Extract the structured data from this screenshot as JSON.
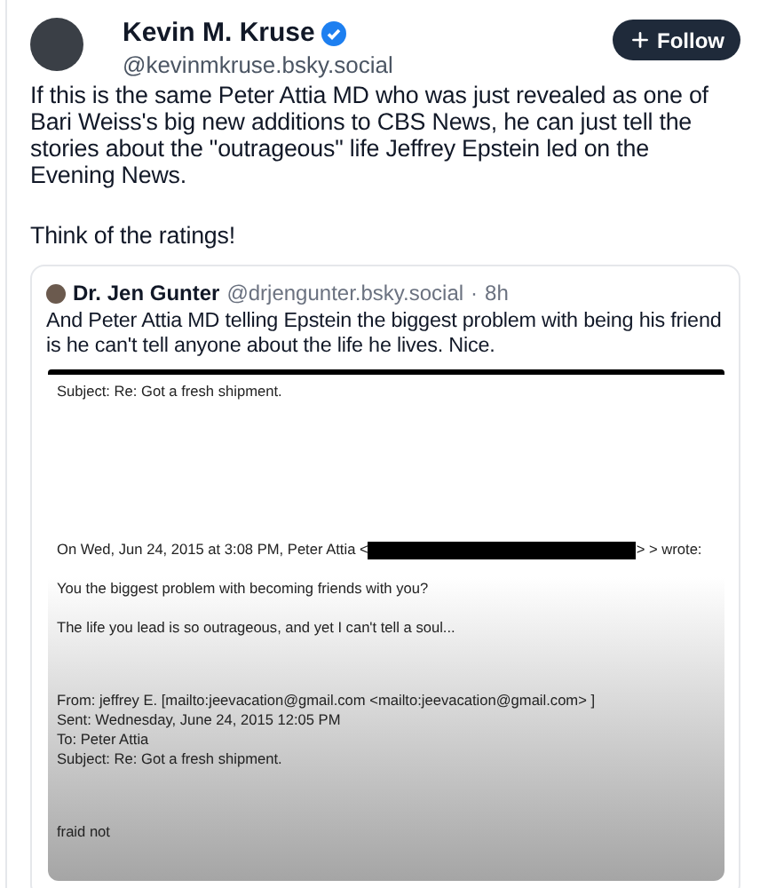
{
  "post": {
    "author": {
      "name": "Kevin M. Kruse",
      "verified": true,
      "handle": "@kevinmkruse.bsky.social"
    },
    "follow_button": "Follow",
    "paragraphs": [
      "If this is the same Peter Attia MD who was just revealed as one of Bari Weiss's big new additions to CBS News, he can just tell the stories about the \"outrageous\" life Jeffrey Epstein led on the Evening News.",
      "Think of the ratings!"
    ],
    "quote": {
      "author": {
        "name": "Dr. Jen Gunter",
        "handle": "@drjengunter.bsky.social",
        "separator": "·",
        "time": "8h"
      },
      "text": "And Peter Attia MD telling Epstein the biggest problem with being his friend is he can't tell anyone about the life he lives. Nice.",
      "email": {
        "subject": "Subject: Re: Got a fresh shipment.",
        "reply_header": {
          "prefix": "On Wed, Jun 24, 2015 at 3:08 PM, Peter Attia <",
          "suffix": "> > wrote:"
        },
        "quoted_lines": [
          "You the biggest problem with becoming friends with you?",
          "The life you lead is so outrageous, and yet I can't tell a soul..."
        ],
        "header_lines": [
          "From: jeffrey E. [mailto:jeevacation@gmail.com <mailto:jeevacation@gmail.com> ]",
          "Sent: Wednesday, June 24, 2015 12:05 PM",
          "To: Peter Attia",
          "Subject: Re: Got a fresh shipment."
        ],
        "body": "fraid not"
      }
    }
  }
}
